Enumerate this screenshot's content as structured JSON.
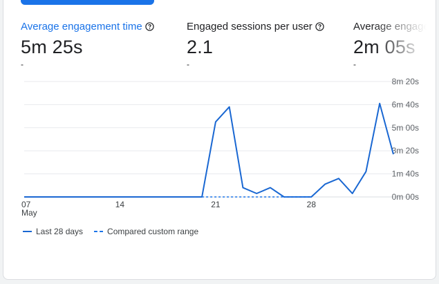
{
  "metrics": [
    {
      "label": "Average engagement time",
      "value": "5m 25s",
      "compare": "-",
      "active": true
    },
    {
      "label": "Engaged sessions per user",
      "value": "2.1",
      "compare": "-",
      "active": false
    },
    {
      "label": "Average engagem",
      "value": "2m 05s",
      "compare": "-",
      "active": false
    }
  ],
  "legend": {
    "current": "Last 28 days",
    "compare": "Compared custom range"
  },
  "colors": {
    "accent": "#1a73e8",
    "line": "#1967d2",
    "grid": "#e8eaed"
  },
  "chart_data": {
    "type": "line",
    "title": "",
    "xlabel": "",
    "ylabel": "",
    "x_ticks": [
      {
        "label": "07",
        "sublabel": "May",
        "index": 0
      },
      {
        "label": "14",
        "index": 7
      },
      {
        "label": "21",
        "index": 14
      },
      {
        "label": "28",
        "index": 21
      }
    ],
    "y_ticks": [
      "0m 00s",
      "1m 40s",
      "3m 20s",
      "5m 00s",
      "6m 40s",
      "8m 20s"
    ],
    "ylim_seconds": [
      0,
      500
    ],
    "series": [
      {
        "name": "Last 28 days",
        "style": "solid",
        "values_seconds": [
          0,
          0,
          0,
          0,
          0,
          0,
          0,
          0,
          0,
          0,
          0,
          0,
          0,
          0,
          325,
          390,
          40,
          15,
          40,
          0,
          0,
          0,
          55,
          80,
          15,
          110,
          405,
          185
        ]
      },
      {
        "name": "Compared custom range",
        "style": "dashed",
        "values_seconds": [
          0,
          0,
          0,
          0,
          0,
          0,
          0,
          0,
          0,
          0,
          0,
          0,
          0,
          0,
          0,
          0,
          0,
          0,
          0,
          0,
          0,
          0,
          0,
          0,
          0,
          0,
          0,
          0
        ]
      }
    ],
    "grid": true,
    "legend_position": "bottom-left"
  }
}
